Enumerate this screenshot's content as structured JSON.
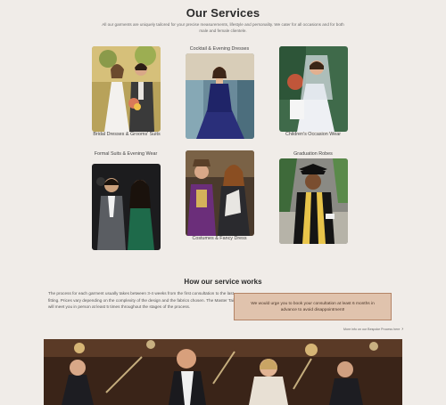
{
  "page": {
    "title": "Our Services",
    "intro": "All our garments are uniquely tailored for your precise measurements, lifestyle and personality. We cater for all occasions and for both male and female clientele."
  },
  "services": [
    {
      "label": "Bridal Dresses & Grooms' Suits"
    },
    {
      "label": "Cocktail & Evening Dresses"
    },
    {
      "label": "Children's Occasion Wear"
    },
    {
      "label": "Formal Suits & Evening Wear"
    },
    {
      "label": "Costumes & Fancy Dress"
    },
    {
      "label": "Graduation Robes"
    }
  ],
  "how": {
    "title": "How our service works",
    "process": "The process for each garment usually takes between 3-4 weeks from the first consultation to the last fitting. Prices vary depending on the complexity of the design and the fabrics chosen. The Master Tailor will meet you in person at least 5 times throughout the stages of the process.",
    "notice": "We would urge you to book your consultation at least 6 months in advance to avoid disappointment!",
    "more_link": "More info on our Bespoke Process here"
  },
  "colors": {
    "background": "#f0ece8",
    "notice_bg": "#e0c3ad",
    "notice_border": "#b48466"
  },
  "icons": {
    "more_link_icon": "chevron-right-icon"
  }
}
